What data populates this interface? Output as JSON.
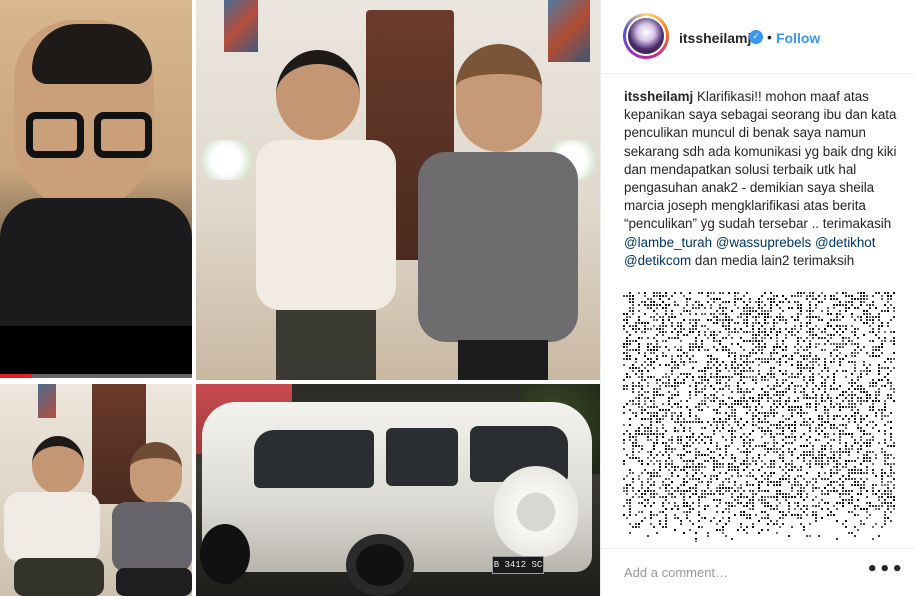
{
  "media": {
    "video_progress": 0.16,
    "car_plate": "B 3412 SC"
  },
  "post": {
    "username": "itssheilamj",
    "verified_icon": "✓",
    "separator": "•",
    "follow_label": "Follow",
    "caption": {
      "user": "itssheilamj",
      "text": "Klarifikasi!! mohon maaf atas kepanikan saya sebagai seorang ibu dan kata penculikan muncul di benak saya namun sekarang sdh ada komunikasi yg baik dng kiki dan mendapatkan solusi terbaik utk hal pengasuhan anak2 - demikian saya sheila marcia joseph mengklarifikasi atas berita “penculikan” yg sudah tersebar .. terimakasih",
      "mention1": "@lambe_turah",
      "mention2": "@wassuprebels",
      "mention3": "@detikhot",
      "mention4": "@detikcom",
      "tail": "dan media lain2 terimaksih"
    }
  },
  "comment": {
    "placeholder": "Add a comment…",
    "more_label": "•••"
  },
  "colors": {
    "accent": "#3897f0",
    "mention": "#003569",
    "progress": "#e02020"
  }
}
